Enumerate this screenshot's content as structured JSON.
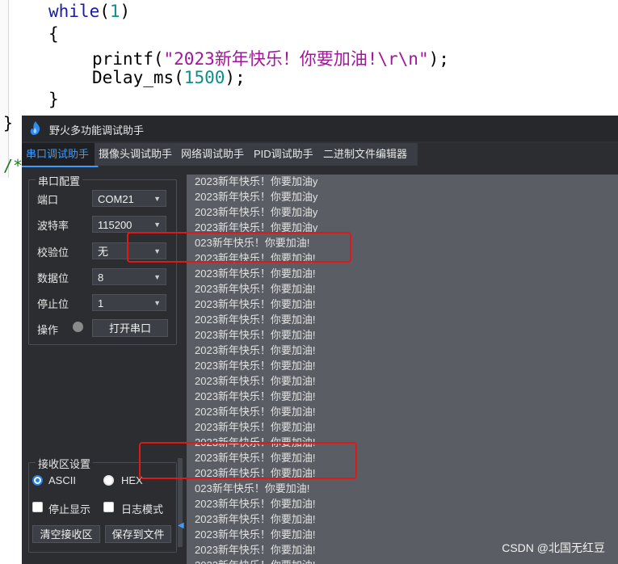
{
  "code": {
    "lines": [
      "while(1)",
      "{",
      "printf(\"2023新年快乐！你要加油!\\r\\n\");",
      "Delay_ms(1500);",
      "}"
    ],
    "while_kw": "while",
    "while_open": "(",
    "while_num": "1",
    "while_close": ")",
    "open_brace": "{",
    "printf_fn": "printf(",
    "printf_str": "\"2023新年快乐！你要加油!\\r\\n\"",
    "printf_end": ");",
    "delay_fn": "Delay_ms(",
    "delay_num": "1500",
    "delay_end": ");",
    "close_brace": "}",
    "outer_brace": "}",
    "comment_start": "/*"
  },
  "app": {
    "title": "野火多功能调试助手",
    "tabs": [
      "串口调试助手",
      "摄像头调试助手",
      "网络调试助手",
      "PID调试助手",
      "二进制文件编辑器"
    ]
  },
  "serial_config": {
    "group_title": "串口配置",
    "port_label": "端口",
    "port_value": "COM21",
    "baud_label": "波特率",
    "baud_value": "115200",
    "parity_label": "校验位",
    "parity_value": "无",
    "databits_label": "数据位",
    "databits_value": "8",
    "stopbits_label": "停止位",
    "stopbits_value": "1",
    "op_label": "操作",
    "open_button": "打开串口"
  },
  "receive_settings": {
    "group_title": "接收区设置",
    "ascii_label": "ASCII",
    "hex_label": "HEX",
    "stop_display_label": "停止显示",
    "log_mode_label": "日志模式",
    "clear_button": "清空接收区",
    "save_button": "保存到文件",
    "selected_mode": "ASCII"
  },
  "receive_lines": [
    "2023新年快乐！你要加油y",
    "2023新年快乐！你要加油y",
    "2023新年快乐！你要加油y",
    "2023新年快乐！你要加油y",
    "023新年快乐！你要加油!",
    "2023新年快乐！你要加油!",
    "2023新年快乐！你要加油!",
    "2023新年快乐！你要加油!",
    "2023新年快乐！你要加油!",
    "2023新年快乐！你要加油!",
    "2023新年快乐！你要加油!",
    "2023新年快乐！你要加油!",
    "2023新年快乐！你要加油!",
    "2023新年快乐！你要加油!",
    "2023新年快乐！你要加油!",
    "2023新年快乐！你要加油!",
    "2023新年快乐！你要加油!",
    "2023新年快乐！你要加油!",
    "2023新年快乐！你要加油!",
    "2023新年快乐！你要加油!",
    "023新年快乐！你要加油!",
    "2023新年快乐！你要加油!",
    "2023新年快乐！你要加油!",
    "2023新年快乐！你要加油!",
    "2023新年快乐！你要加油!",
    "2023新年快乐！你要加油!"
  ],
  "watermark": "CSDN @北国无红豆",
  "colors": {
    "accent": "#3d9bff",
    "highlight": "#e01818",
    "app_bg": "#2b2d31",
    "recv_bg": "#5a5d63"
  }
}
